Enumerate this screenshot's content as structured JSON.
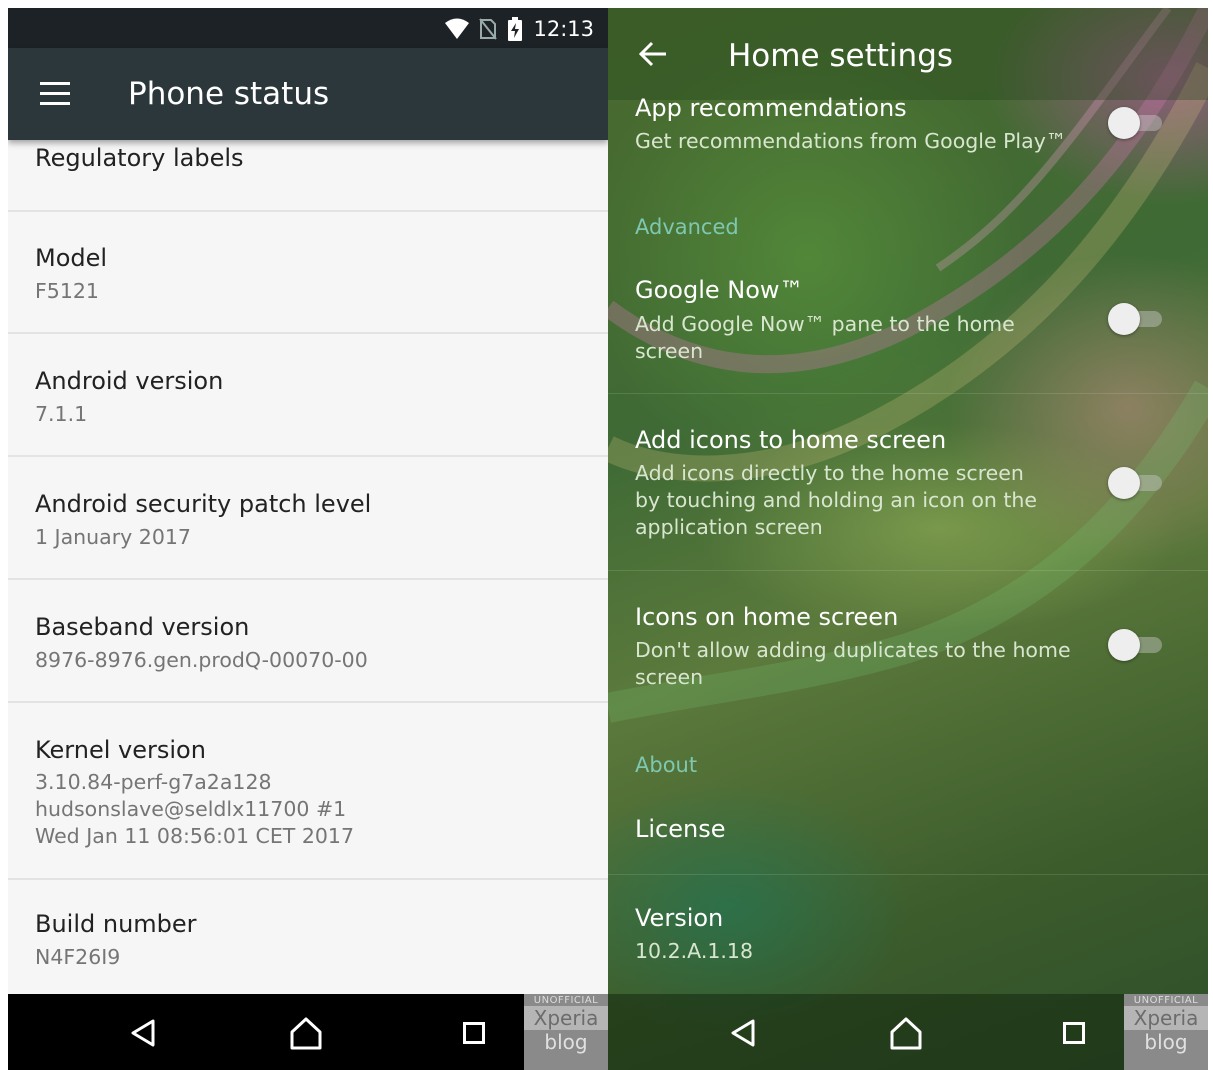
{
  "left": {
    "status_bar": {
      "time": "12:13",
      "icons": [
        "wifi-icon",
        "no-sim-icon",
        "battery-charging-icon"
      ]
    },
    "app_bar": {
      "menu_icon": "hamburger-menu-icon",
      "title": "Phone status"
    },
    "items": [
      {
        "title": "Regulatory labels",
        "subtitle": ""
      },
      {
        "title": "Model",
        "subtitle": "F5121"
      },
      {
        "title": "Android version",
        "subtitle": "7.1.1"
      },
      {
        "title": "Android security patch level",
        "subtitle": "1 January 2017"
      },
      {
        "title": "Baseband version",
        "subtitle": "8976-8976.gen.prodQ-00070-00"
      },
      {
        "title": "Kernel version",
        "subtitle": "3.10.84-perf-g7a2a128\nhudsonslave@seldlx11700 #1\nWed Jan 11 08:56:01 CET 2017"
      },
      {
        "title": "Build number",
        "subtitle": "N4F26I9"
      }
    ],
    "nav": {
      "back": "back-icon",
      "home": "home-icon",
      "recents": "recents-icon"
    }
  },
  "right": {
    "app_bar": {
      "back_icon": "back-arrow-icon",
      "title": "Home settings"
    },
    "items": [
      {
        "title": "App recommendations",
        "subtitle": "Get recommendations from Google Play™",
        "toggle": false
      },
      {
        "section": "Advanced"
      },
      {
        "title": "Google Now™",
        "subtitle": "Add Google Now™ pane to the home\nscreen",
        "toggle": false
      },
      {
        "title": "Add icons to home screen",
        "subtitle": "Add icons directly to the home screen\nby touching and holding an icon on the\napplication screen",
        "toggle": false
      },
      {
        "title": "Icons on home screen",
        "subtitle": "Don't allow adding duplicates to the home\nscreen",
        "toggle": false
      },
      {
        "section": "About"
      },
      {
        "title": "License"
      },
      {
        "title": "Version",
        "subtitle": "10.2.A.1.18"
      }
    ],
    "nav": {
      "back": "back-icon",
      "home": "home-icon",
      "recents": "recents-icon"
    }
  },
  "watermark": {
    "line1": "UNOFFICIAL",
    "line2": "Xperia",
    "line3": "blog"
  },
  "colors": {
    "left_appbar": "#2c373c",
    "left_statusbar": "#1c2226",
    "section_header": "#7ec7b0",
    "wallpaper_green": "#4a6a2e"
  }
}
